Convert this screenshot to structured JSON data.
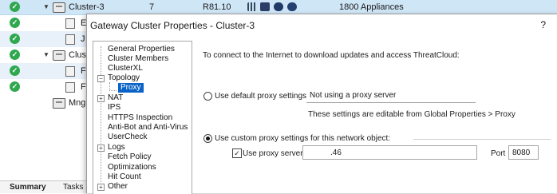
{
  "background": {
    "top_row": {
      "name": "Cluster-3",
      "count": "7",
      "version": "R81.10",
      "appliances": "1800 Appliances"
    },
    "rows": [
      {
        "label": "E"
      },
      {
        "label": "J"
      },
      {
        "label": "Clust"
      },
      {
        "label": "F"
      },
      {
        "label": "F"
      },
      {
        "label": "Mng"
      }
    ],
    "tabs": [
      "Summary",
      "Tasks"
    ]
  },
  "dialog": {
    "title": "Gateway Cluster Properties - Cluster-3",
    "help": "?",
    "tree": [
      {
        "label": "General Properties"
      },
      {
        "label": "Cluster Members"
      },
      {
        "label": "ClusterXL"
      },
      {
        "label": "Topology"
      },
      {
        "label": "Proxy"
      },
      {
        "label": "NAT"
      },
      {
        "label": "IPS"
      },
      {
        "label": "HTTPS Inspection"
      },
      {
        "label": "Anti-Bot and Anti-Virus"
      },
      {
        "label": "UserCheck"
      },
      {
        "label": "Logs"
      },
      {
        "label": "Fetch Policy"
      },
      {
        "label": "Optimizations"
      },
      {
        "label": "Hit Count"
      },
      {
        "label": "Other"
      }
    ],
    "content": {
      "intro": "To connect to the Internet to download updates and access ThreatCloud:",
      "default_proxy_label": "Use default proxy settings:",
      "default_proxy_value": "Not using a proxy server",
      "default_hint": "These settings are editable from Global Properties > Proxy",
      "custom_proxy_label": "Use custom proxy settings for this network object:",
      "use_proxy_server_label": "Use proxy server:",
      "proxy_server_value": ".46",
      "port_label": "Port",
      "port_value": "8080"
    }
  }
}
